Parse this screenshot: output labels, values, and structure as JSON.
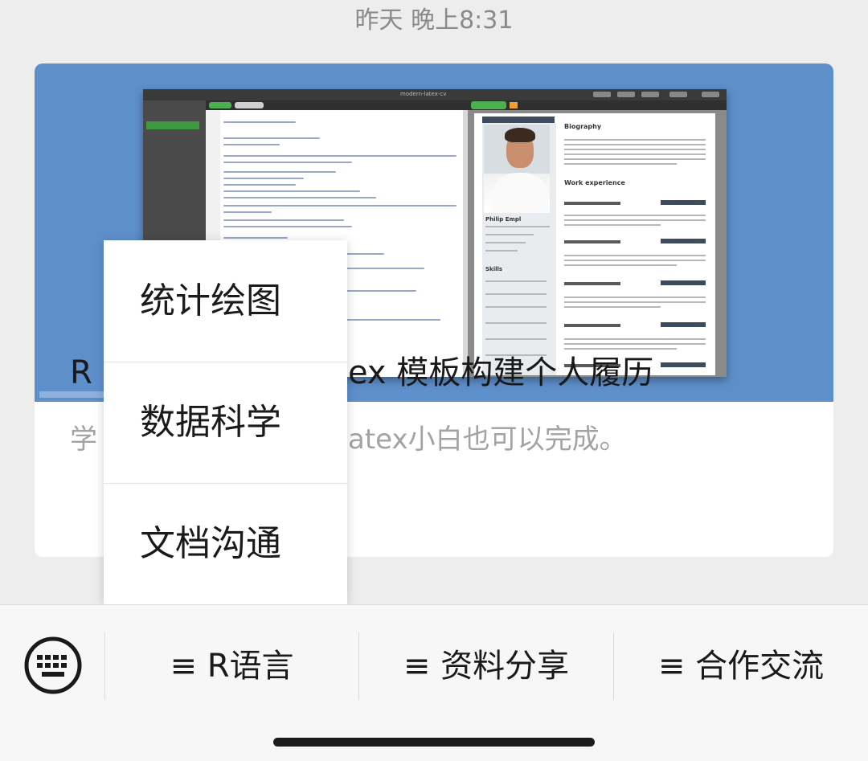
{
  "header": {
    "timestamp": "昨天 晚上8:31"
  },
  "article": {
    "title_start": "R",
    "title_end": "ex 模板构建个人履历",
    "desc_start": "学",
    "desc_end": "atex小白也可以完成。",
    "cover": {
      "window_title": "modern-latex-cv",
      "cv_name": "Philip Empl",
      "cv_section_bio": "Biography",
      "cv_section_work": "Work experience",
      "cv_section_skills": "Skills"
    }
  },
  "popup": {
    "items": [
      "统计绘图",
      "数据科学",
      "文档沟通"
    ]
  },
  "bottom_menu": {
    "items": [
      "≡ R语言",
      "≡ 资料分享",
      "≡ 合作交流"
    ]
  },
  "colors": {
    "cover_bg": "#5d8fcb",
    "accent_green": "#4caf50",
    "page_bg": "#ededed"
  }
}
